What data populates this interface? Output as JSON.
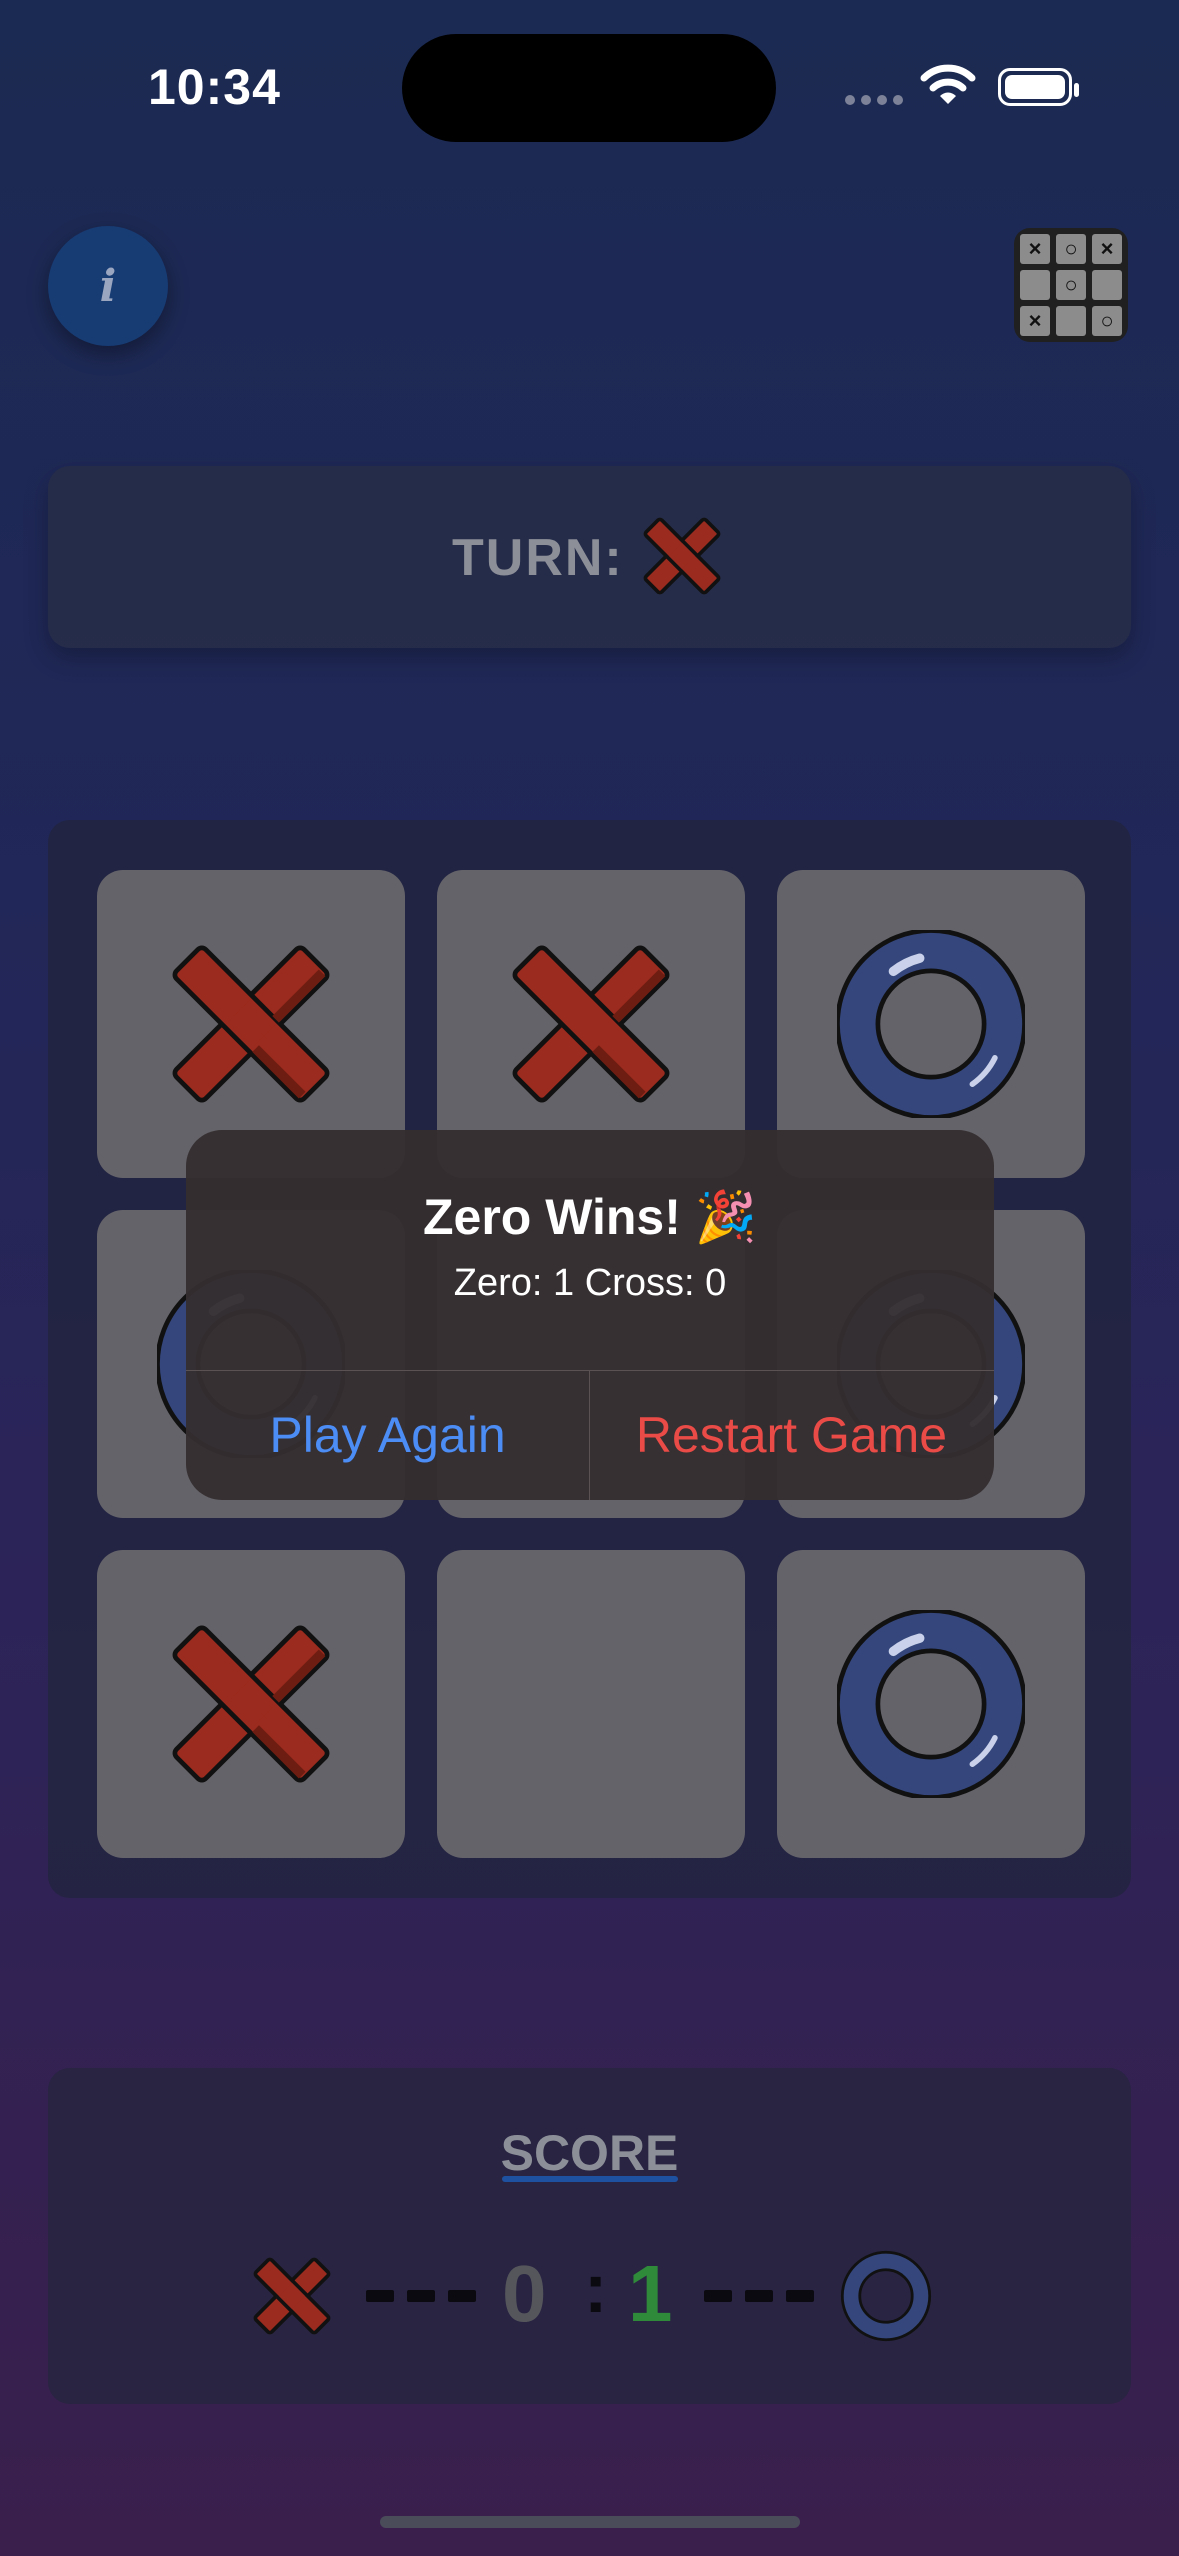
{
  "status_bar": {
    "time": "10:34"
  },
  "header": {
    "info_icon": "i",
    "board_icon": "tic-tac-toe-board-icon"
  },
  "turn": {
    "label": "TURN:",
    "current_player": "cross"
  },
  "board": {
    "cells": [
      "X",
      "X",
      "O",
      "O",
      "",
      "O",
      "X",
      "",
      "O"
    ],
    "colors": {
      "cross": "#9b2b1e",
      "zero": "#34467b",
      "cell": "#646369"
    }
  },
  "dialog": {
    "title": "Zero Wins! 🎉",
    "message": "Zero: 1 Cross: 0",
    "play_again": "Play Again",
    "restart": "Restart Game"
  },
  "score": {
    "title": "SCORE",
    "cross": "0",
    "separator": ":",
    "zero": "1"
  }
}
